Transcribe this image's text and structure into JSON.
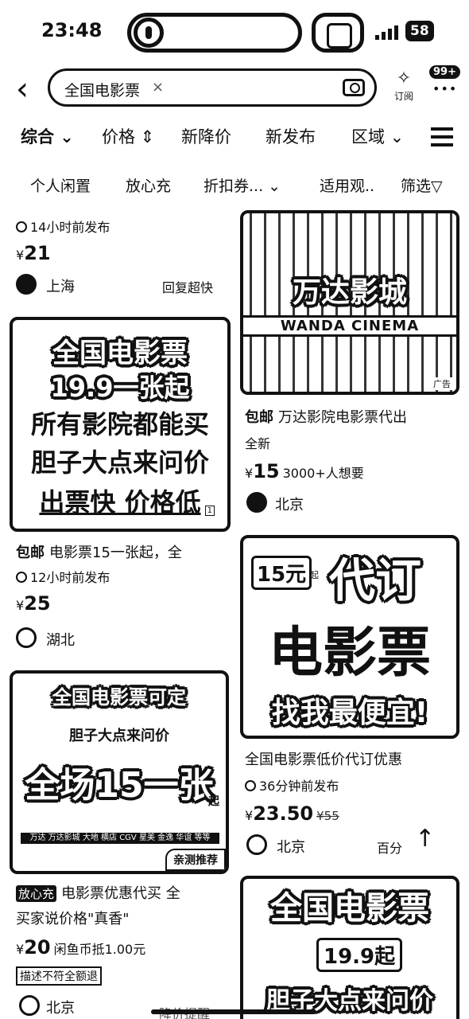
{
  "status_bar": {
    "time": "23:48",
    "battery": "58"
  },
  "search": {
    "query": "全国电影票",
    "clear": "×"
  },
  "header": {
    "subscribe_label": "订阅",
    "message_badge": "99+",
    "message_dots": "•••"
  },
  "tabs": [
    {
      "label": "综合 ⌄",
      "active": true
    },
    {
      "label": "价格 ⇕"
    },
    {
      "label": "新降价"
    },
    {
      "label": "新发布"
    },
    {
      "label": "区域 ⌄"
    }
  ],
  "filters": [
    "个人闲置",
    "放心充",
    "折扣券... ⌄",
    "适用观..",
    "筛选▽"
  ],
  "left_col": {
    "item1": {
      "time": "14小时前发布",
      "yen": "¥",
      "price": "21",
      "location": "上海",
      "note": "回复超快"
    },
    "item2": {
      "img_lines": [
        "全国电影票",
        "19.9一张起",
        "所有影院都能买",
        "胆子大点来问价",
        "出票快 价格低"
      ],
      "img_corner": "1",
      "tag": "包邮",
      "title": "电影票15一张起，全",
      "time": "12小时前发布",
      "yen": "¥",
      "price": "25",
      "location": "湖北"
    },
    "item3": {
      "img_lines": [
        "全国电影票可定",
        "胆子大点来问价",
        "全场15一张",
        "万达 万达影城 大地 横店 CGV 星美 金逸 华谊 等等",
        "亲测推荐"
      ],
      "img_side": "起",
      "tag": "放心充",
      "title": "电影票优惠代买 全",
      "subtitle": "买家说价格\"真香\"",
      "yen": "¥",
      "price": "20",
      "price_extra": "闲鱼币抵1.00元",
      "box_label": "描述不符全额退",
      "location": "北京",
      "cut_text": "降价提醒"
    }
  },
  "right_col": {
    "item1": {
      "img_lines": [
        "万达影城",
        "WANDA CINEMA"
      ],
      "img_corner": "广告",
      "tag": "包邮",
      "title": "万达影院电影票代出",
      "sub": "全新",
      "yen": "¥",
      "price": "15",
      "price_extra": "3000+人想要",
      "location": "北京"
    },
    "item2": {
      "img_lines": [
        "15元",
        "代订",
        "电影票",
        "找我最便宜!"
      ],
      "img_small": "起",
      "title": "全国电影票低价代订优惠",
      "time": "36分钟前发布",
      "yen": "¥",
      "price": "23.50",
      "original_price": "¥55",
      "location": "北京",
      "note": "百分",
      "scroll_top": "↑"
    },
    "item3": {
      "img_lines": [
        "全国电影票",
        "19.9起",
        "胆子大点来问价"
      ]
    }
  }
}
